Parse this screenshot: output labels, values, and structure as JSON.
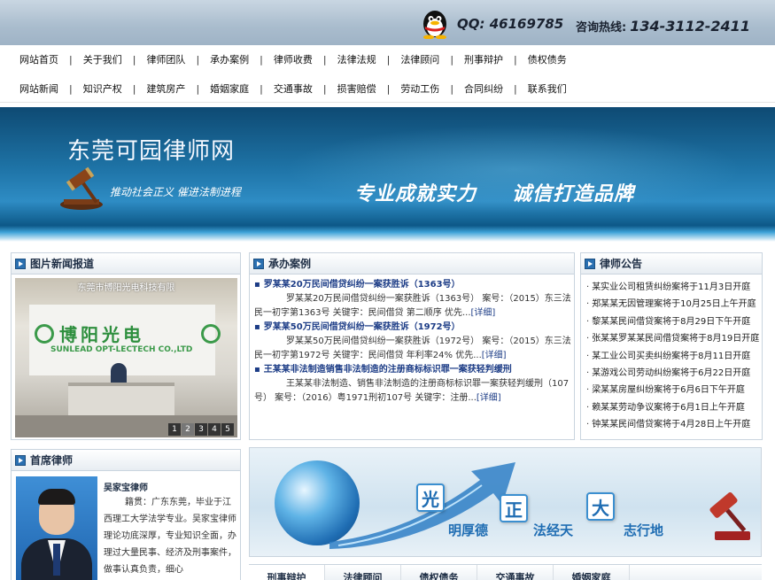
{
  "header": {
    "qq_label": "QQ: 46169785",
    "hotline_label": "咨询热线:",
    "hotline_number": "134-3112-2411"
  },
  "nav_primary": [
    "网站首页",
    "关于我们",
    "律师团队",
    "承办案例",
    "律师收费",
    "法律法规",
    "法律顾问",
    "刑事辩护",
    "债权债务"
  ],
  "nav_secondary": [
    "网站新闻",
    "知识产权",
    "建筑房产",
    "婚姻家庭",
    "交通事故",
    "损害赔偿",
    "劳动工伤",
    "合同纠纷",
    "联系我们"
  ],
  "banner": {
    "title": "东莞可园律师网",
    "slogan": "推动社会正义  催进法制进程",
    "slogan2": "专业成就实力",
    "slogan3": "诚信打造品牌"
  },
  "photo_news": {
    "title": "图片新闻报道",
    "caption": "东莞市博阳光电科技有限",
    "sign": "博阳光电",
    "sign_en": "SUNLEAD OPT-LECTECH CO.,LTD",
    "pages": [
      "1",
      "2",
      "3",
      "4",
      "5"
    ],
    "active_page": "2"
  },
  "cases": {
    "title": "承办案例",
    "items": [
      {
        "title": "罗某某20万民间借贷纠纷一案获胜诉（1363号）",
        "body": "罗某某20万民间借贷纠纷一案获胜诉（1363号） 案号：（2015）东三法民一初字第1363号 关键字：民间借贷 第二顺序 优先...",
        "more": "[详细]"
      },
      {
        "title": "罗某某50万民间借贷纠纷一案获胜诉（1972号）",
        "body": "罗某某50万民间借贷纠纷一案获胜诉（1972号） 案号：（2015）东三法民一初字第1972号 关键字：民间借贷 年利率24% 优先...",
        "more": "[详细]"
      },
      {
        "title": "王某某非法制造销售非法制造的注册商标标识罪一案获轻判缓刑",
        "body": "王某某非法制造、销售非法制造的注册商标标识罪一案获轻判缓刑（107号） 案号：（2016）粤1971刑初107号 关键字：注册...",
        "more": "[详细]"
      }
    ]
  },
  "notices": {
    "title": "律师公告",
    "items": [
      "某实业公司租赁纠纷案将于11月3日开庭",
      "郑某某无因管理案将于10月25日上午开庭",
      "黎某某民间借贷案将于8月29日下午开庭",
      "张某某罗某某民间借贷案将于8月19日开庭",
      "某工业公司买卖纠纷案将于8月11日开庭",
      "某游戏公司劳动纠纷案将于6月22日开庭",
      "梁某某房屋纠纷案将于6月6日下午开庭",
      "赖某某劳动争议案将于6月1日上午开庭",
      "钟某某民间借贷案将于4月28日上午开庭"
    ]
  },
  "chief_lawyer": {
    "title": "首席律师",
    "name": "吴家宝律师",
    "bio": "籍贯：广东东莞，毕业于江西理工大学法学专业。吴家宝律师理论功底深厚，专业知识全面，办理过大量民事、经济及刑事案件，做事认真负责，细心"
  },
  "ad_banner": {
    "chars": [
      "光",
      "正",
      "大"
    ],
    "phrases": [
      "明厚德",
      "法经天",
      "志行地"
    ]
  },
  "bottom_tabs": [
    "刑事辩护",
    "法律顾问",
    "债权债务",
    "交通事故",
    "婚姻家庭"
  ],
  "colors": {
    "accent": "#2a6fb0",
    "link": "#1c3c86",
    "topbar": "#a9bccd"
  }
}
